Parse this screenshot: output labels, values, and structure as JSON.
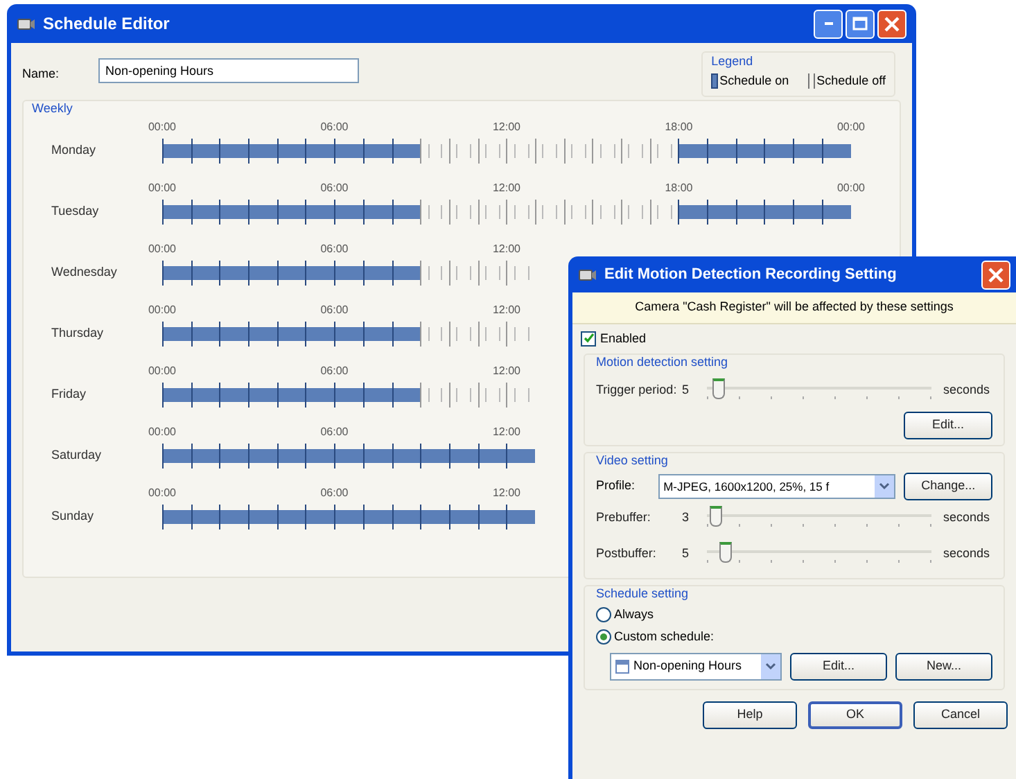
{
  "schedule_editor": {
    "title": "Schedule Editor",
    "name_label": "Name:",
    "name_value": "Non-opening Hours",
    "legend": {
      "title": "Legend",
      "on_label": "Schedule on",
      "off_label": "Schedule off"
    },
    "weekly": {
      "title": "Weekly",
      "days": [
        {
          "name": "Monday",
          "time_labels": [
            "00:00",
            "06:00",
            "12:00",
            "18:00",
            "00:00"
          ],
          "slots": [
            true,
            true,
            true,
            true,
            true,
            true,
            true,
            true,
            true,
            false,
            false,
            false,
            false,
            false,
            false,
            false,
            false,
            false,
            true,
            true,
            true,
            true,
            true,
            true
          ]
        },
        {
          "name": "Tuesday",
          "time_labels": [
            "00:00",
            "06:00",
            "12:00",
            "18:00",
            "00:00"
          ],
          "slots": [
            true,
            true,
            true,
            true,
            true,
            true,
            true,
            true,
            true,
            false,
            false,
            false,
            false,
            false,
            false,
            false,
            false,
            false,
            true,
            true,
            true,
            true,
            true,
            true
          ]
        },
        {
          "name": "Wednesday",
          "time_labels": [
            "00:00",
            "06:00",
            "12:00"
          ],
          "slots": [
            true,
            true,
            true,
            true,
            true,
            true,
            true,
            true,
            true,
            false,
            false,
            false,
            false
          ]
        },
        {
          "name": "Thursday",
          "time_labels": [
            "00:00",
            "06:00",
            "12:00"
          ],
          "slots": [
            true,
            true,
            true,
            true,
            true,
            true,
            true,
            true,
            true,
            false,
            false,
            false,
            false
          ]
        },
        {
          "name": "Friday",
          "time_labels": [
            "00:00",
            "06:00",
            "12:00"
          ],
          "slots": [
            true,
            true,
            true,
            true,
            true,
            true,
            true,
            true,
            true,
            false,
            false,
            false,
            false
          ]
        },
        {
          "name": "Saturday",
          "time_labels": [
            "00:00",
            "06:00",
            "12:00"
          ],
          "slots": [
            true,
            true,
            true,
            true,
            true,
            true,
            true,
            true,
            true,
            true,
            true,
            true,
            true
          ]
        },
        {
          "name": "Sunday",
          "time_labels": [
            "00:00",
            "06:00",
            "12:00"
          ],
          "slots": [
            true,
            true,
            true,
            true,
            true,
            true,
            true,
            true,
            true,
            true,
            true,
            true,
            true
          ]
        }
      ]
    }
  },
  "dialog": {
    "title": "Edit Motion Detection Recording Setting",
    "info": "Camera \"Cash Register\" will be affected by these settings",
    "enabled": {
      "label": "Enabled",
      "checked": true
    },
    "motion": {
      "title": "Motion detection setting",
      "sliders": [
        {
          "label": "Trigger period:",
          "value": "5",
          "level": 0.05,
          "unit": "seconds"
        }
      ],
      "button": "Edit..."
    },
    "video": {
      "title": "Video setting",
      "profile_label": "Profile:",
      "profile_value": "M-JPEG, 1600x1200, 25%, 15 f",
      "change_button": "Change...",
      "sliders": [
        {
          "label": "Prebuffer:",
          "value": "3",
          "level": 0.04,
          "unit": "seconds"
        },
        {
          "label": "Postbuffer:",
          "value": "5",
          "level": 0.08,
          "unit": "seconds"
        }
      ]
    },
    "schedule": {
      "title": "Schedule setting",
      "options": [
        {
          "label": "Always",
          "selected": false
        },
        {
          "label": "Custom schedule:",
          "selected": true
        }
      ],
      "schedule_value": "Non-opening Hours",
      "edit_button": "Edit...",
      "new_button": "New..."
    },
    "buttons": [
      {
        "label": "Help",
        "default": false
      },
      {
        "label": "OK",
        "default": true
      },
      {
        "label": "Cancel",
        "default": false
      }
    ]
  }
}
